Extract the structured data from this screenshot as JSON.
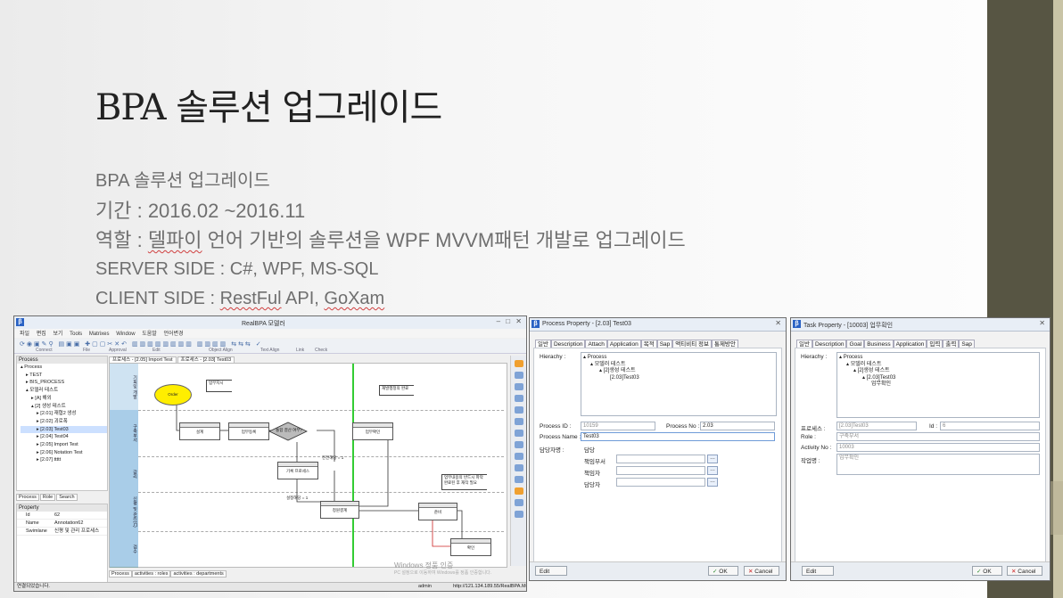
{
  "slide": {
    "title": "BPA 솔루션 업그레이드",
    "bullets": [
      "BPA 솔루션 업그레이드",
      "기간 : 2016.02 ~2016.11",
      "역할 : 델파이 언어 기반의 솔루션을 WPF MVVM패턴 개발로 업그레이드",
      "SERVER SIDE : C#, WPF, MS-SQL",
      "CLIENT SIDE   : RestFul API, GoXam"
    ]
  },
  "main_app": {
    "title": "RealBPA 모델러",
    "menu": [
      "파일",
      "편집",
      "보기",
      "Tools",
      "Matrixes",
      "Window",
      "도움말",
      "언어변경"
    ],
    "toolbar_groups": [
      "Connect",
      "File",
      "Approval",
      "Edit",
      "Object Align",
      "Text Align",
      "Link",
      "Check"
    ],
    "tree_header": "Process",
    "tree": [
      "Process",
      "TEST",
      "BIS_PROCESS",
      "모델러 테스트",
      "[A] 해외",
      "[2] 생성 테스트",
      "[2.01] 재협2 생성",
      "[2.02] 괴로폭",
      "[2.03] Test03",
      "[2.04] Test04",
      "[2.05] Import Test",
      "[2.06] Notation Test",
      "[2.07] ttttt"
    ],
    "panel_tabs": [
      "Process",
      "Role",
      "Search"
    ],
    "property_header": "Property",
    "properties": [
      {
        "k": "Id",
        "v": "62"
      },
      {
        "k": "Name",
        "v": "Annotation62"
      },
      {
        "k": "Swimlane",
        "v": "신평 및 관리 프로세스"
      }
    ],
    "canvas_tabs": [
      "프로세스 - [2.05] Import Test",
      "프로세스 - [2.03] Test03"
    ],
    "lanes": [
      "기획및 개발",
      "구축부서",
      "감리",
      "신평 및 관리(C)",
      "검수"
    ],
    "diagram": {
      "start": "Order",
      "tasks": [
        "설계",
        "업무등록",
        "통합 결산 여부?",
        "기록 프로세스",
        "업무확인",
        "청원결계",
        "준비",
        "확인"
      ],
      "notes": [
        "업무지시",
        "재발행정의 완료",
        "업무내용의 반드시 파악 완료된 후 재작 필요"
      ],
      "flows": [
        "진전해당 = 1",
        "설정해당 = 1"
      ]
    },
    "bottom_tabs": [
      "Process",
      "activities : roles",
      "activities : departments"
    ],
    "status": {
      "left": "연결되었습니다.",
      "user": "admin",
      "url": "http://121.134.189.55/RealBPA.Modeler"
    },
    "watermark": "Windows 정품 인증",
    "watermark2": "PC 설정으로 이동하여 Windows를 정품 인증합니다."
  },
  "process_window": {
    "title": "Process Property - [2.03] Test03",
    "tabs": [
      "일반",
      "Description",
      "Attach",
      "Application",
      "목적",
      "Sap",
      "액티비티 정보",
      "통제방안"
    ],
    "hierarchy_label": "Hierachy :",
    "hierarchy": [
      "Process",
      "모델러 테스트",
      "[2]생성 테스트",
      "[2.03]Test03"
    ],
    "process_id_label": "Process ID :",
    "process_id": "10159",
    "process_no_label": "Process No :",
    "process_no": "2.03",
    "process_name_label": "Process Name :",
    "process_name": "Test03",
    "owner_label": "담당자명 :",
    "owner_sub": "담당",
    "fields": [
      "책임부서",
      "책임자",
      "담당자"
    ],
    "edit": "Edit",
    "ok": "OK",
    "cancel": "Cancel"
  },
  "task_window": {
    "title": "Task Property - [10003] 업무확인",
    "tabs": [
      "일반",
      "Description",
      "Goal",
      "Business",
      "Application",
      "입력",
      "출력",
      "Sap"
    ],
    "hierarchy_label": "Hierachy :",
    "hierarchy": [
      "Process",
      "모델러 테스트",
      "[2]생성 테스트",
      "[2.03]Test03",
      "업무확인"
    ],
    "process_label": "프로세스 :",
    "process_value": "[2.03]Test03",
    "id_label": "Id :",
    "id_value": "6",
    "role_label": "Role :",
    "role_value": "구축부서",
    "activity_label": "Activity No :",
    "activity_value": "10003",
    "work_label": "작업명 :",
    "work_value": "업무확인",
    "edit": "Edit",
    "ok": "OK",
    "cancel": "Cancel"
  },
  "colors": {
    "side_band": "#575543",
    "start_event": "#ffee00",
    "milestone_line": "#33cc33",
    "lane_header": "#a9cde8"
  }
}
